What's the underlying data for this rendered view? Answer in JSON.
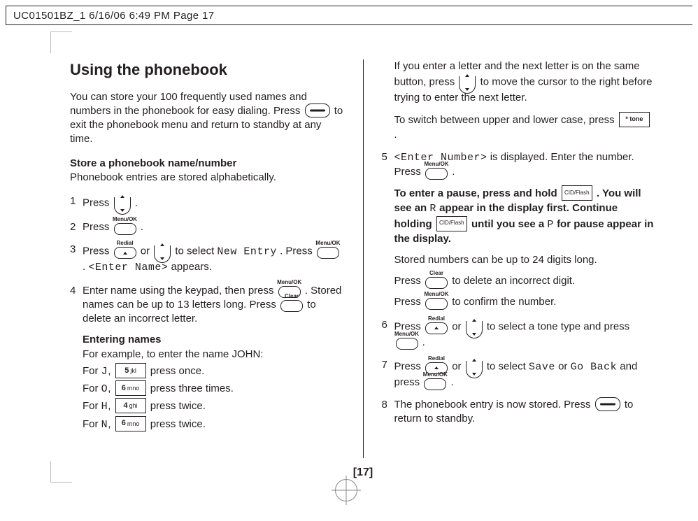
{
  "header": "UC01501BZ_1  6/16/06  6:49 PM  Page 17",
  "page_number": "[17]",
  "left": {
    "title": "Using the phonebook",
    "intro_a": "You can store your 100 frequently used names and numbers in the phonebook for easy dialing. Press ",
    "intro_b": " to exit the phonebook menu and return to standby at any time.",
    "store_heading": "Store a phonebook name/number",
    "store_sub": "Phonebook entries are stored alphabetically.",
    "step1": "Press ",
    "step1_end": " .",
    "step2": "Press ",
    "step2_end": " .",
    "step3_a": "Press ",
    "step3_b": " or ",
    "step3_c": " to select ",
    "step3_newentry": "New Entry",
    "step3_d": ". Press ",
    "step3_e": " . ",
    "step3_entername": "<Enter Name>",
    "step3_f": " appears.",
    "step4_a": "Enter name using the keypad, then press ",
    "step4_b": " . Stored names can be up to 13 letters long. Press ",
    "step4_c": " to delete an incorrect letter.",
    "entering_heading": "Entering names",
    "entering_example": "For example, to enter the name JOHN:",
    "j_a": "For ",
    "j_char": "J",
    "j_b": ", ",
    "j_c": " press once.",
    "o_a": "For ",
    "o_char": "O",
    "o_b": ", ",
    "o_c": " press three times.",
    "h_a": "For ",
    "h_char": "H",
    "h_b": ", ",
    "h_c": " press twice.",
    "n_a": "For ",
    "n_char": "N",
    "n_b": ", ",
    "n_c": " press twice."
  },
  "right": {
    "topnote_a": "If you enter a letter and the next letter is on the same button, press ",
    "topnote_b": " to move the cursor to the right before trying to enter the next letter.",
    "case_a": "To switch between upper and lower case, press ",
    "case_b": " .",
    "step5_tag": "<Enter Number>",
    "step5_b": " is displayed. Enter the number. Press ",
    "step5_c": " .",
    "pause_a": "To enter a pause, press and hold ",
    "pause_b": " . You will see an ",
    "pause_r": "R",
    "pause_c": " appear in the display first. Continue holding ",
    "pause_d": " until you see a ",
    "pause_p": "P",
    "pause_e": " for pause appear in the display.",
    "stored_len": "Stored numbers can be up to 24 digits long.",
    "del_a": "Press ",
    "del_b": " to delete an incorrect digit.",
    "conf_a": "Press ",
    "conf_b": " to confirm the number.",
    "step6_a": "Press ",
    "step6_b": " or ",
    "step6_c": " to select a tone type and press ",
    "step6_d": " .",
    "step7_a": "Press ",
    "step7_b": " or ",
    "step7_c": " to select ",
    "step7_save": "Save",
    "step7_or": " or ",
    "step7_goback": "Go Back",
    "step7_d": " and press ",
    "step7_e": " .",
    "step8_a": "The phonebook entry is now stored. Press ",
    "step8_b": " to return to standby."
  },
  "key_labels": {
    "menu_ok": "Menu/OK",
    "redial": "Redial",
    "clear": "Clear",
    "tone": "* tone",
    "cid_flash": "CID/Flash",
    "k5": "5",
    "k5sub": "jkl",
    "k6": "6",
    "k6sub": "mno",
    "k4": "4",
    "k4sub": "ghi"
  }
}
